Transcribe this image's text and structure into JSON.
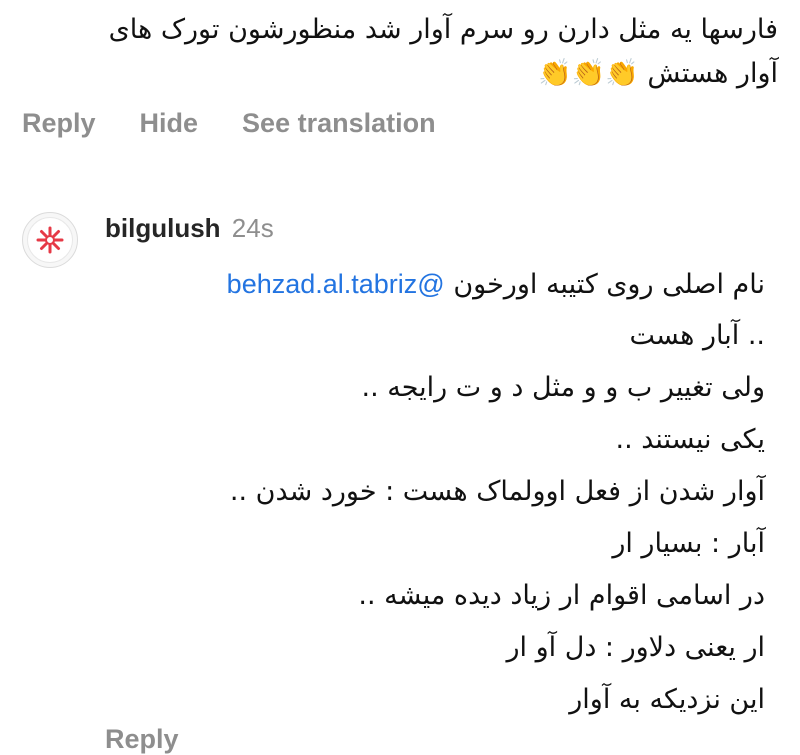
{
  "previous_comment": {
    "line1": "فارسها یه مثل دارن رو سرم آوار شد منظورشون تورک های",
    "line2": "آوار هستش 👏👏👏"
  },
  "actions": {
    "reply": "Reply",
    "hide": "Hide",
    "see_translation": "See translation"
  },
  "reply_comment": {
    "username": "bilgulush",
    "timestamp": "24s",
    "mention": "@behzad.al.tabriz",
    "first_line_text": "نام اصلی روی کتیبه اورخون",
    "lines": [
      ".. آبار هست",
      "ولی تغییر ب و و مثل د و ت رایجه ..",
      "یکی نیستند ..",
      "آوار شدن از فعل اوولماک هست : خورد شدن ..",
      "آبار : بسیار ار",
      "در اسامی اقوام ار زیاد دیده میشه ..",
      "ار یعنی دلاور : دل آو ار",
      "این نزدیکه به آوار"
    ],
    "next_action_label": "Reply"
  },
  "avatar": {
    "icon": "red-asterisk-logo-icon",
    "color": "#e63946"
  },
  "colors": {
    "action_gray": "#8e8e8e",
    "mention_blue": "#2374e1",
    "text": "#111111"
  }
}
